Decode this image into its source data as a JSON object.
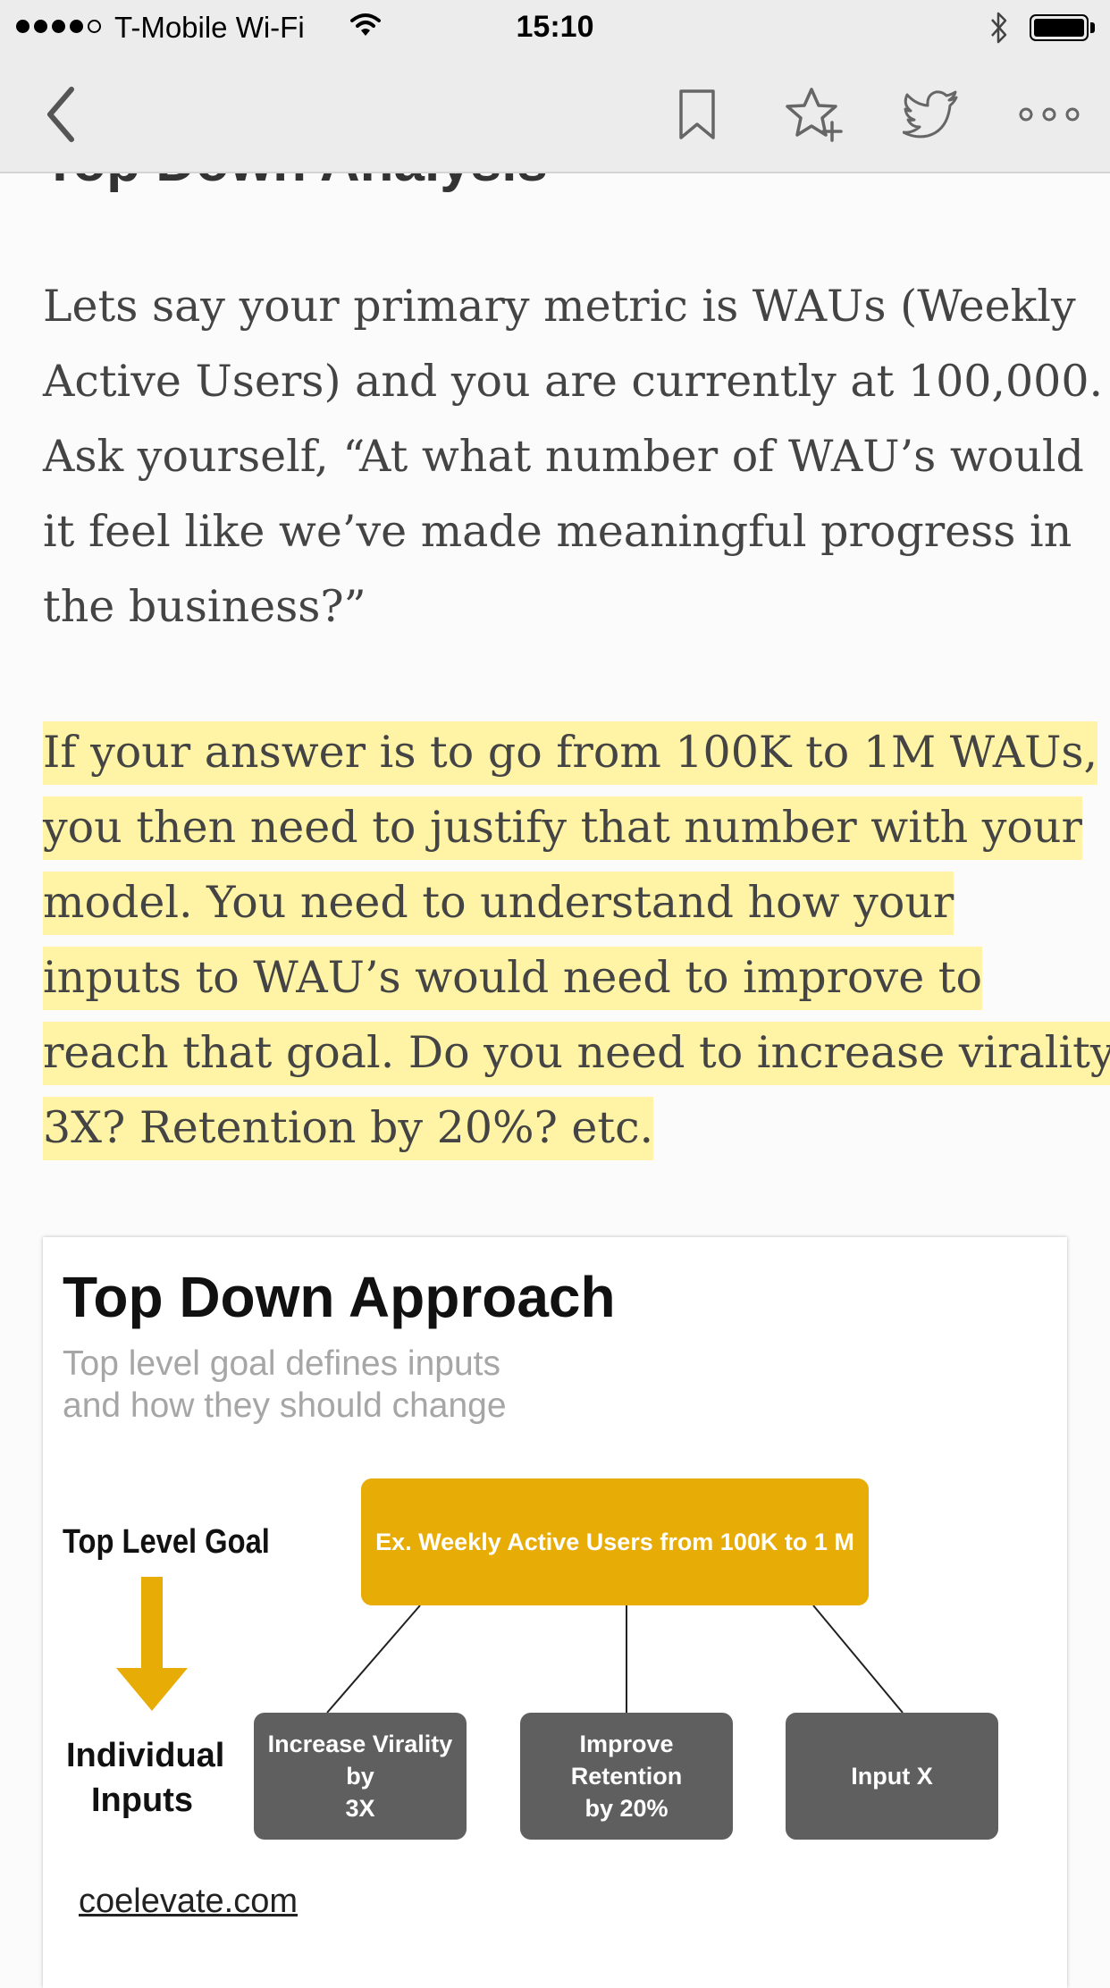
{
  "status_bar": {
    "carrier": "T-Mobile Wi-Fi",
    "time": "15:10",
    "signal_bars_filled": 4,
    "signal_bars_total": 5
  },
  "toolbar": {
    "icons": [
      "back-icon",
      "bookmark-icon",
      "star-add-icon",
      "twitter-icon",
      "more-icon"
    ]
  },
  "article": {
    "heading": "Top Down Analysis",
    "paragraph1": [
      "Lets say your primary metric is WAUs (Weekly",
      "Active Users) and you are currently at 100,000.",
      "Ask yourself, “At what number of WAU’s would",
      "it feel like we’ve made meaningful progress in",
      "the business?”"
    ],
    "paragraph2_highlighted": [
      "If your answer is to go from 100K to 1M WAUs,",
      "you then need to justify that number with your",
      "model. You need to understand how your",
      "inputs to WAU’s would need to improve to",
      "reach that goal. Do you need to increase virality",
      "3X?  Retention by 20%? etc. "
    ],
    "highlight_color": "#fff3a6"
  },
  "figure": {
    "title": "Top Down Approach",
    "subtitle_line1": "Top level goal defines inputs",
    "subtitle_line2": "and how they should change",
    "label_goal": "Top Level Goal",
    "label_inputs_line1": "Individual",
    "label_inputs_line2": "Inputs",
    "goal_box": "Ex. Weekly Active Users from 100K to 1 M",
    "inputs": [
      {
        "line1": "Increase Virality by",
        "line2": "3X"
      },
      {
        "line1": "Improve Retention",
        "line2": "by 20%"
      },
      {
        "line1": "Input X",
        "line2": ""
      }
    ],
    "link": "coelevate.com",
    "colors": {
      "goal": "#e8ac06",
      "input": "#5f5f5f"
    }
  }
}
